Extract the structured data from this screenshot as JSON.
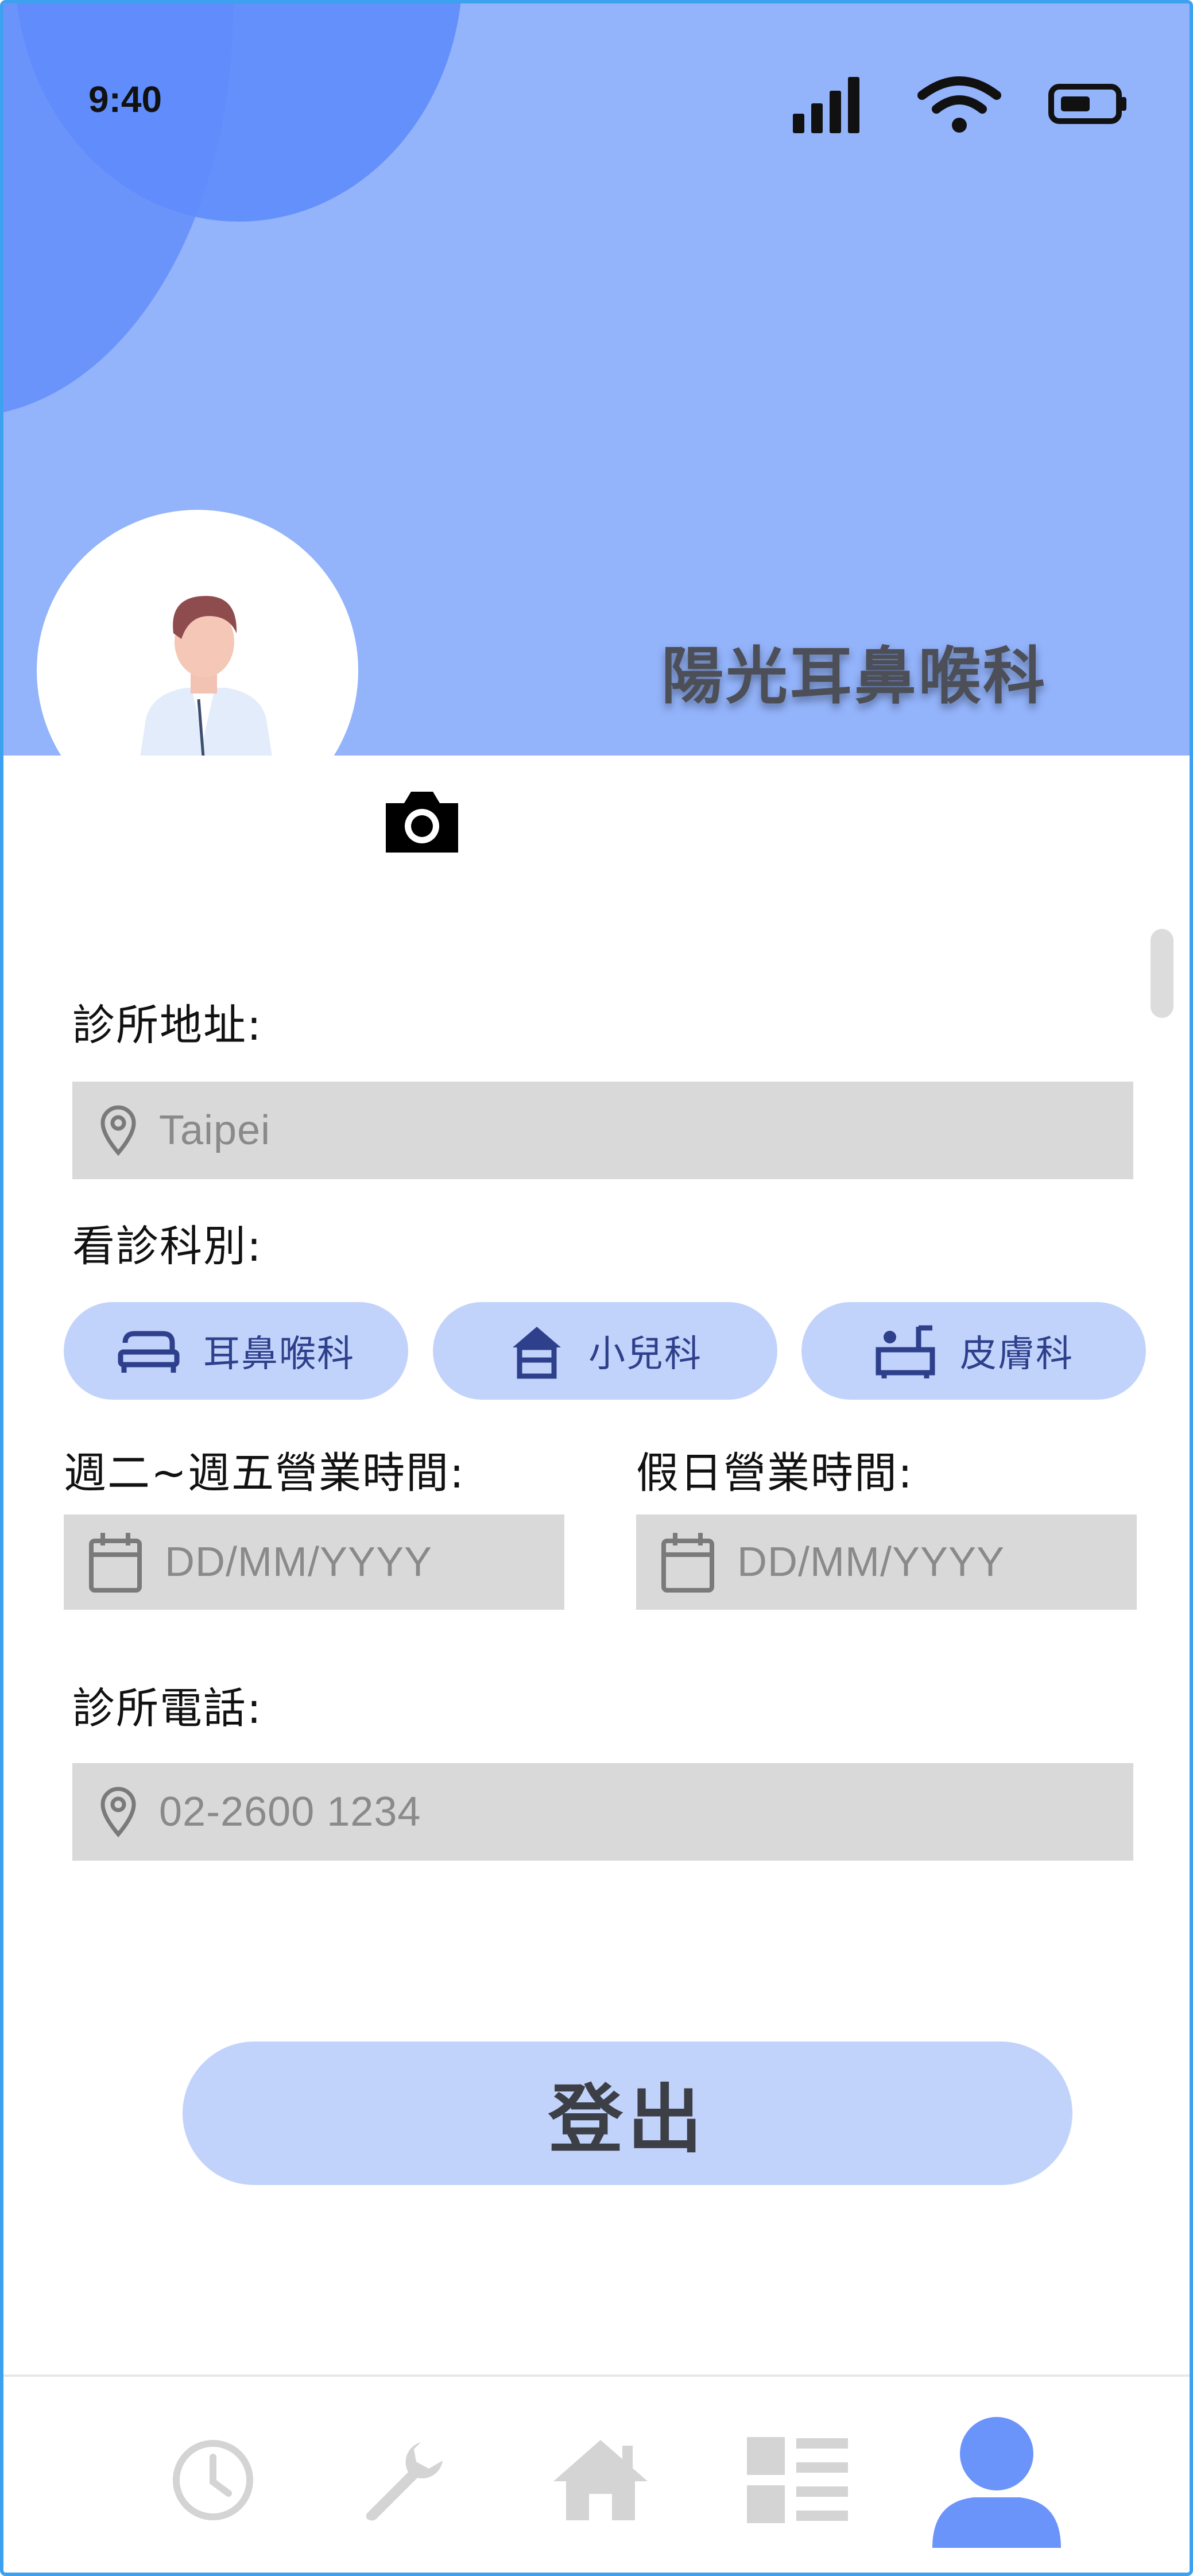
{
  "status_bar": {
    "time": "9:40",
    "icons": [
      "signal-icon",
      "wifi-icon",
      "battery-icon"
    ]
  },
  "header": {
    "clinic_name": "陽光耳鼻喉科",
    "avatar_icon": "doctor-avatar",
    "camera_icon": "camera-icon"
  },
  "form": {
    "address_label": "診所地址:",
    "address_placeholder": "Taipei",
    "specialty_label": "看診科別:",
    "specialties": [
      {
        "label": "耳鼻喉科",
        "icon": "bed-icon"
      },
      {
        "label": "小兒科",
        "icon": "house-icon"
      },
      {
        "label": "皮膚科",
        "icon": "bath-icon"
      }
    ],
    "weekday_hours_label": "週二~週五營業時間:",
    "weekday_hours_placeholder": "DD/MM/YYYY",
    "holiday_hours_label": "假日營業時間:",
    "holiday_hours_placeholder": "DD/MM/YYYY",
    "phone_label": "診所電話:",
    "phone_placeholder": "02-2600 1234"
  },
  "logout_label": "登出",
  "navbar": {
    "items": [
      {
        "icon": "clock-icon",
        "active": false
      },
      {
        "icon": "wrench-icon",
        "active": false
      },
      {
        "icon": "home-icon",
        "active": false
      },
      {
        "icon": "list-icon",
        "active": false
      },
      {
        "icon": "user-icon",
        "active": true
      }
    ]
  },
  "colors": {
    "header_bg": "#93b3fb",
    "accent": "#6b94fb",
    "chip_bg": "#c2d3fb",
    "field_bg": "#d9d9d9",
    "nav_inactive": "#d4d4d4"
  }
}
